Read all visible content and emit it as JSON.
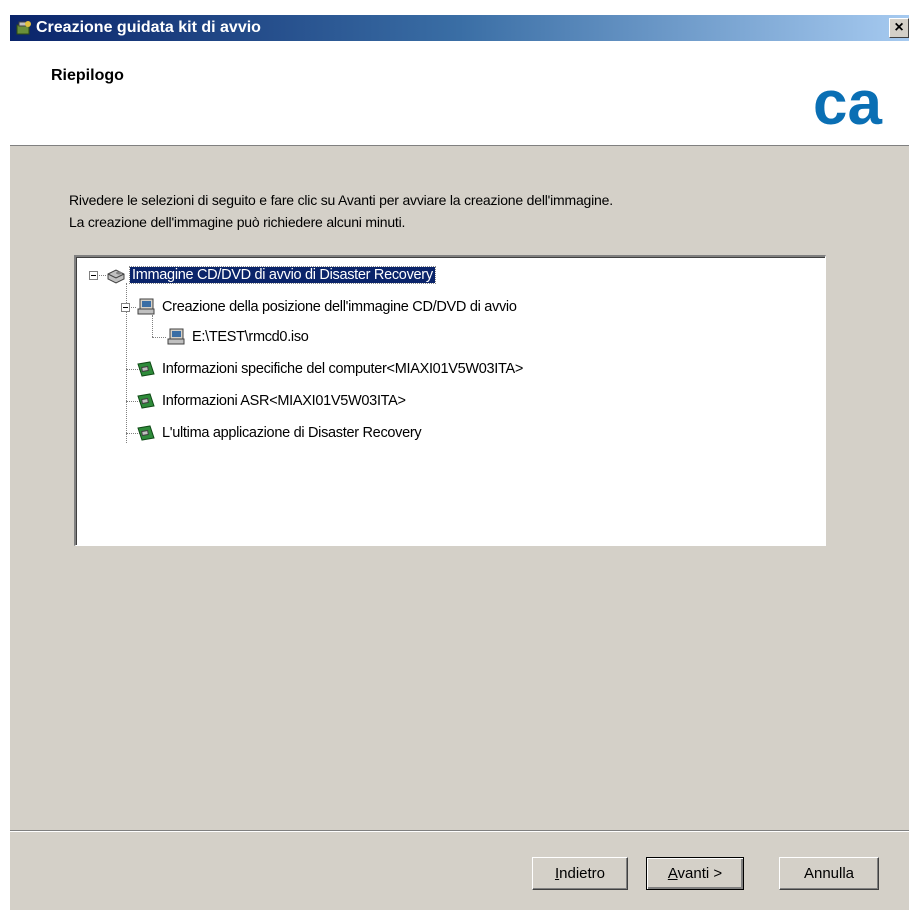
{
  "window": {
    "title": "Creazione guidata kit di avvio",
    "close_label": "×"
  },
  "header": {
    "title": "Riepilogo",
    "logo_text": "ca"
  },
  "intro": {
    "line1": "Rivedere le selezioni di seguito e fare clic su Avanti per avviare la creazione dell'immagine.",
    "line2": "La creazione dell'immagine può richiedere alcuni minuti."
  },
  "tree": {
    "root": "Immagine CD/DVD di avvio di Disaster Recovery",
    "child1": "Creazione della posizione dell'immagine CD/DVD di avvio",
    "child1_sub": "E:\\TEST\\rmcd0.iso",
    "child2": "Informazioni specifiche del computer<MIAXI01V5W03ITA>",
    "child3": "Informazioni ASR<MIAXI01V5W03ITA>",
    "child4": "L'ultima applicazione di Disaster Recovery"
  },
  "buttons": {
    "back_pre": "",
    "back_key": "I",
    "back_post": "ndietro",
    "next_pre": "",
    "next_key": "A",
    "next_post": "vanti >",
    "cancel": "Annulla"
  },
  "colors": {
    "selection": "#0a246a",
    "title_gradient_start": "#0a246a",
    "dialog_bg": "#d4d0c8",
    "logo_blue": "#0a6fb4"
  }
}
